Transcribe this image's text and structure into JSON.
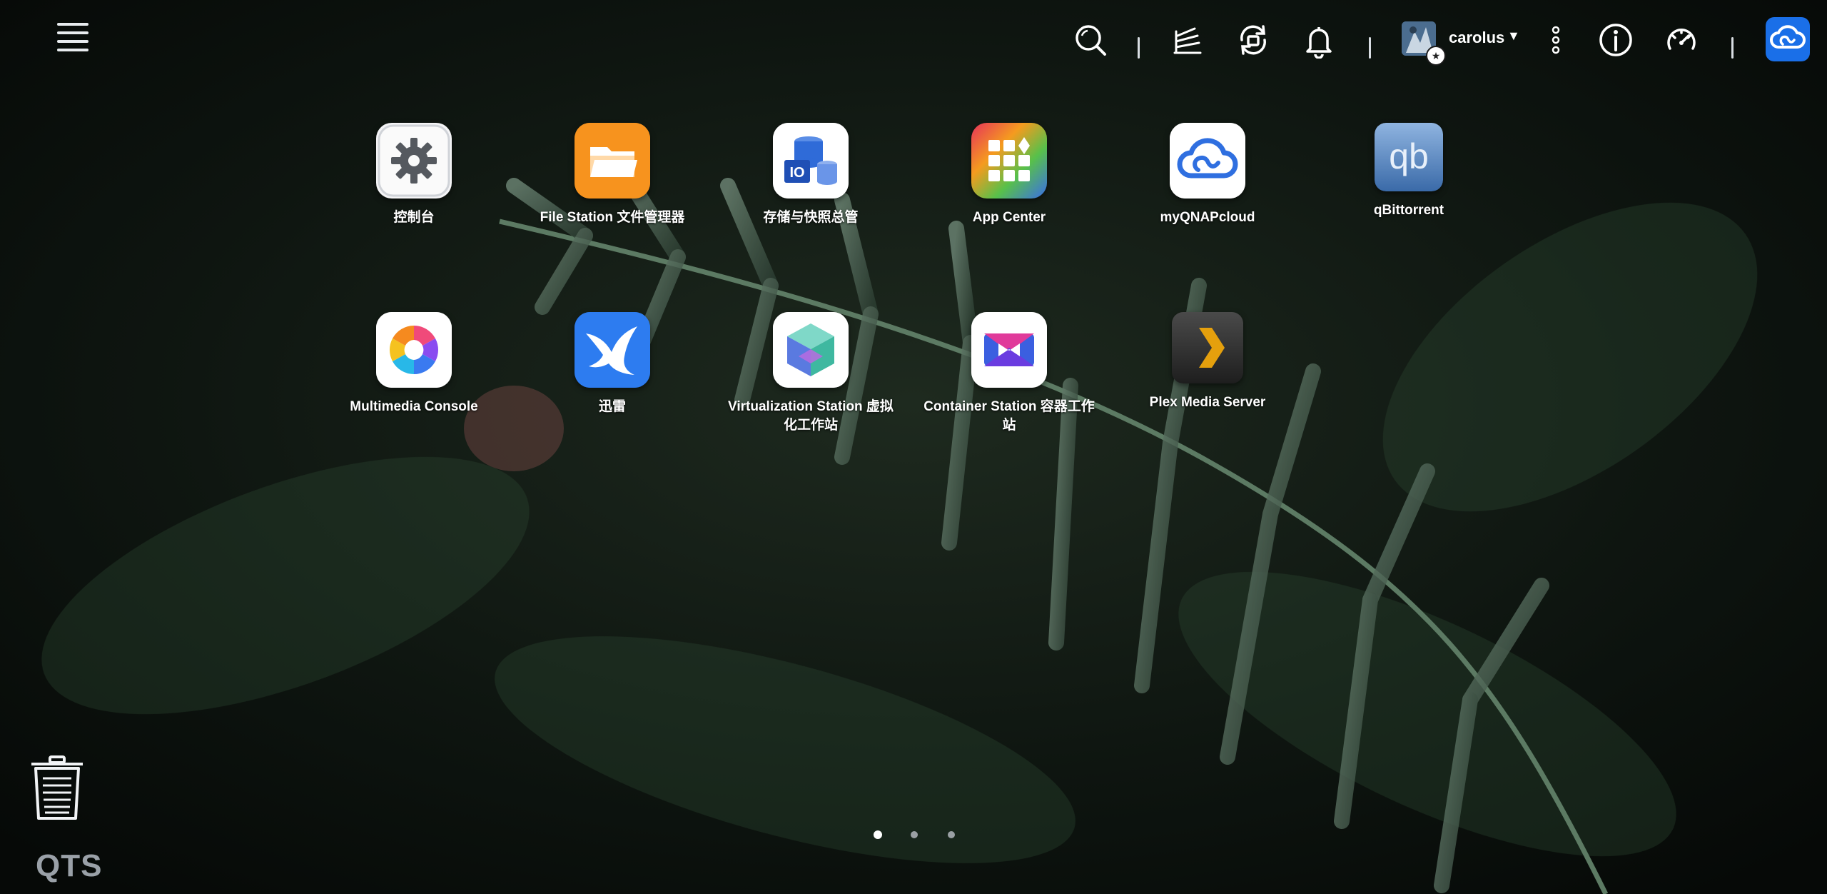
{
  "topbar": {
    "username": "carolus",
    "caret": "▼"
  },
  "apps": [
    {
      "id": "control-panel",
      "label": "控制台"
    },
    {
      "id": "file-station",
      "label": "File Station 文件管理器"
    },
    {
      "id": "storage",
      "label": "存储与快照总管"
    },
    {
      "id": "app-center",
      "label": "App Center"
    },
    {
      "id": "myqnapcloud",
      "label": "myQNAPcloud"
    },
    {
      "id": "qbittorrent",
      "label": "qBittorrent"
    },
    {
      "id": "multimedia-console",
      "label": "Multimedia Console"
    },
    {
      "id": "xunlei",
      "label": "迅雷"
    },
    {
      "id": "virtualization-station",
      "label": "Virtualization Station 虚拟化工作站"
    },
    {
      "id": "container-station",
      "label": "Container Station 容器工作站"
    },
    {
      "id": "plex",
      "label": "Plex Media Server"
    }
  ],
  "footer": {
    "logo": "QTS"
  },
  "pagination": {
    "pages": 3,
    "current": 1
  }
}
